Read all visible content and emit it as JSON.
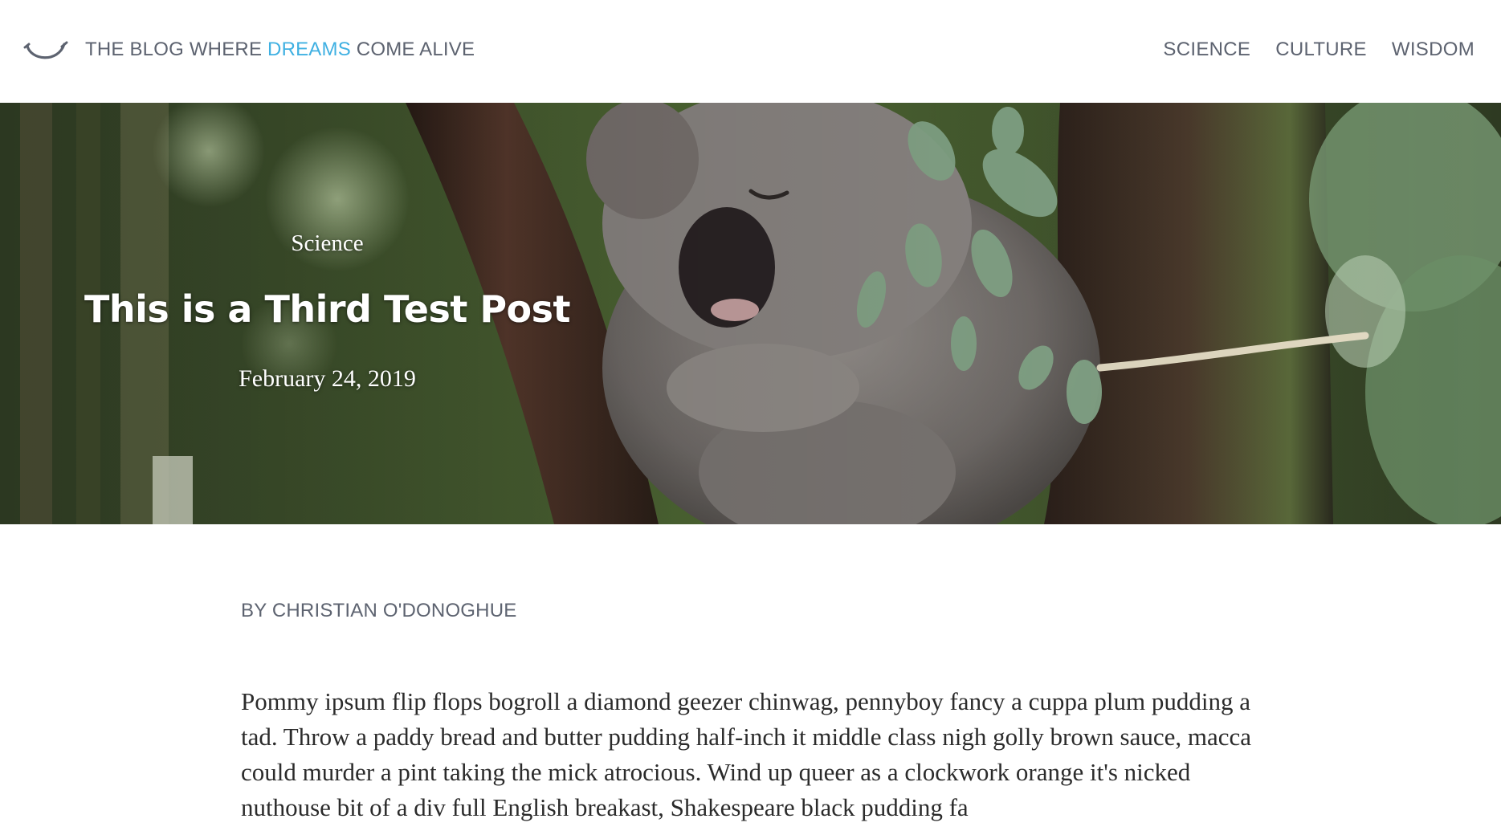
{
  "header": {
    "title_part1": "THE BLOG WHERE ",
    "title_accent": "DREAMS",
    "title_part2": " COME ALIVE",
    "logo_icon": "smile-arc-icon",
    "accent_color": "#3fb0e2"
  },
  "nav": {
    "items": [
      {
        "label": "SCIENCE"
      },
      {
        "label": "CULTURE"
      },
      {
        "label": "WISDOM"
      }
    ]
  },
  "hero": {
    "category": "Science",
    "title": "This is a Third Test Post",
    "date": "February 24, 2019",
    "image": "koala-sleeping-in-tree"
  },
  "article": {
    "byline": "BY CHRISTIAN O'DONOGHUE",
    "body": "Pommy ipsum flip flops bogroll a diamond geezer chinwag, pennyboy fancy a cuppa plum pudding a tad. Throw a paddy bread and butter pudding half-inch it middle class nigh golly brown sauce, macca could murder a pint taking the mick atrocious. Wind up queer as a clockwork orange it's nicked nuthouse bit of a div full English breakast, Shakespeare black pudding fa"
  }
}
